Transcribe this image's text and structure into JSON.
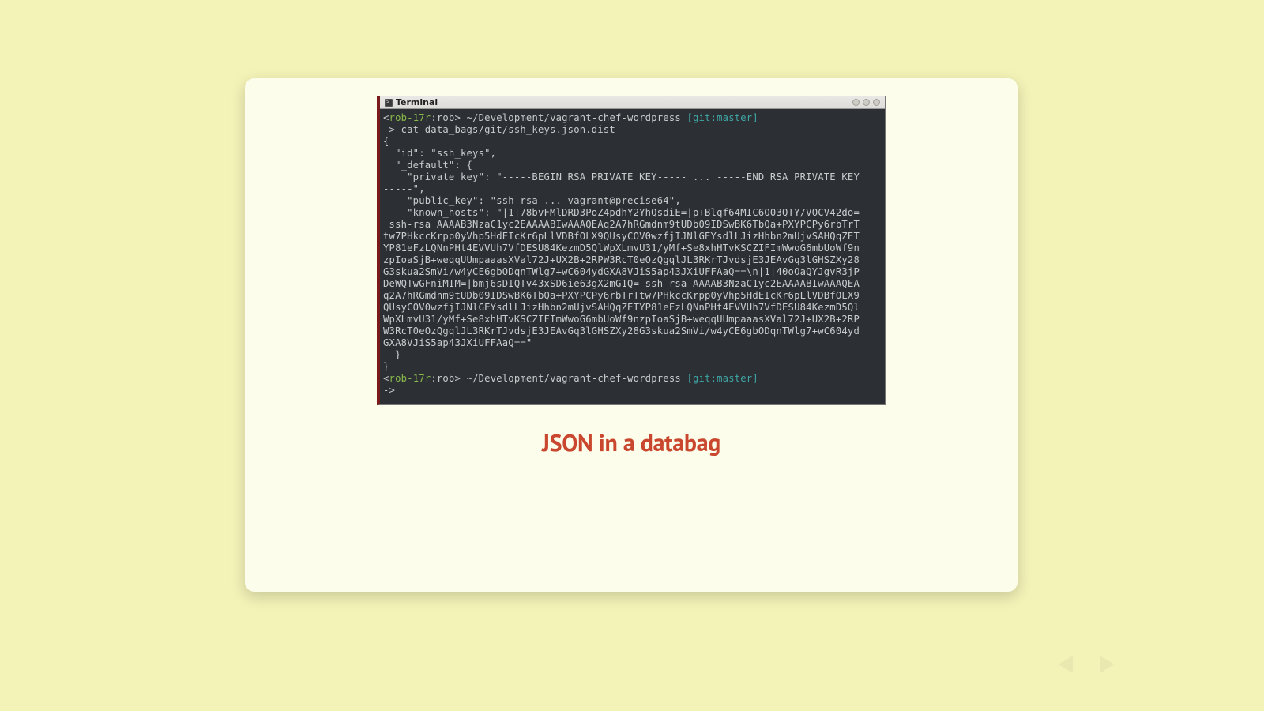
{
  "window": {
    "title": "Terminal"
  },
  "prompt1": {
    "open": "<",
    "user": "rob-17r",
    "sep": ":rob> ",
    "path": "~/Development/vagrant-chef-wordpress ",
    "git": "[git:master]"
  },
  "command": "-> cat data_bags/git/ssh_keys.json.dist",
  "body_lines": [
    "{",
    "  \"id\": \"ssh_keys\",",
    "  \"_default\": {",
    "    \"private_key\": \"-----BEGIN RSA PRIVATE KEY----- ... -----END RSA PRIVATE KEY",
    "-----\",",
    "    \"public_key\": \"ssh-rsa ... vagrant@precise64\",",
    "    \"known_hosts\": \"|1|78bvFMlDRD3PoZ4pdhY2YhQsdiE=|p+Blqf64MIC6O03QTY/VOCV42do=",
    " ssh-rsa AAAAB3NzaC1yc2EAAAABIwAAAQEAq2A7hRGmdnm9tUDb09IDSwBK6TbQa+PXYPCPy6rbTrT",
    "tw7PHkccKrpp0yVhp5HdEIcKr6pLlVDBfOLX9QUsyCOV0wzfjIJNlGEYsdlLJizHhbn2mUjvSAHQqZET",
    "YP81eFzLQNnPHt4EVVUh7VfDESU84KezmD5QlWpXLmvU31/yMf+Se8xhHTvKSCZIFImWwoG6mbUoWf9n",
    "zpIoaSjB+weqqUUmpaaasXVal72J+UX2B+2RPW3RcT0eOzQgqlJL3RKrTJvdsjE3JEAvGq3lGHSZXy28",
    "G3skua2SmVi/w4yCE6gbODqnTWlg7+wC604ydGXA8VJiS5ap43JXiUFFAaQ==\\n|1|40oOaQYJgvR3jP",
    "DeWQTwGFniMIM=|bmj6sDIQTv43xSD6ie63gX2mG1Q= ssh-rsa AAAAB3NzaC1yc2EAAAABIwAAAQEA",
    "q2A7hRGmdnm9tUDb09IDSwBK6TbQa+PXYPCPy6rbTrTtw7PHkccKrpp0yVhp5HdEIcKr6pLlVDBfOLX9",
    "QUsyCOV0wzfjIJNlGEYsdlLJizHhbn2mUjvSAHQqZETYP81eFzLQNnPHt4EVVUh7VfDESU84KezmD5Ql",
    "WpXLmvU31/yMf+Se8xhHTvKSCZIFImWwoG6mbUoWf9nzpIoaSjB+weqqUUmpaaasXVal72J+UX2B+2RP",
    "W3RcT0eOzQgqlJL3RKrTJvdsjE3JEAvGq3lGHSZXy28G3skua2SmVi/w4yCE6gbODqnTWlg7+wC604yd",
    "GXA8VJiS5ap43JXiUFFAaQ==\"",
    "  }",
    "}"
  ],
  "prompt2": {
    "open": "<",
    "user": "rob-17r",
    "sep": ":rob> ",
    "path": "~/Development/vagrant-chef-wordpress ",
    "git": "[git:master]"
  },
  "trailing": "-> ",
  "caption": "JSON in a databag"
}
